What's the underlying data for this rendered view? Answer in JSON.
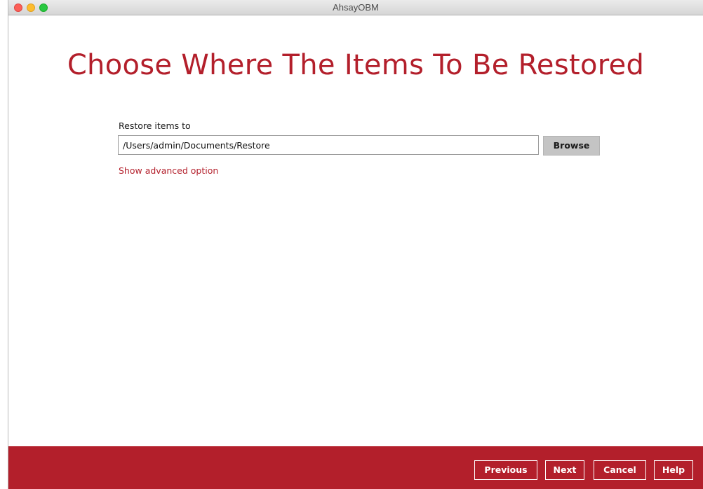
{
  "window": {
    "title": "AhsayOBM"
  },
  "page": {
    "title": "Choose Where The Items To Be Restored"
  },
  "restore": {
    "label": "Restore items to",
    "path_value": "/Users/admin/Documents/Restore",
    "browse_label": "Browse",
    "advanced_link": "Show advanced option"
  },
  "footer": {
    "previous_label": "Previous",
    "next_label": "Next",
    "cancel_label": "Cancel",
    "help_label": "Help"
  },
  "colors": {
    "accent": "#b31f2b",
    "browse_button": "#c4c4c4"
  }
}
